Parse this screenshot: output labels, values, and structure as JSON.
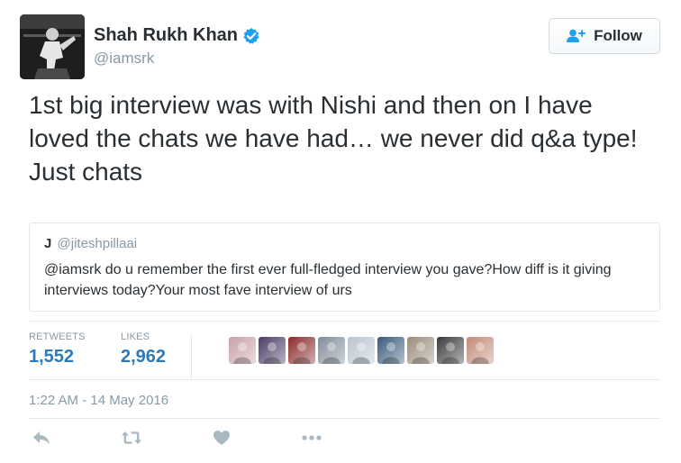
{
  "author": {
    "name": "Shah Rukh Khan",
    "handle": "@iamsrk",
    "verified": true
  },
  "follow_button": {
    "label": "Follow",
    "icon": "add-user-icon"
  },
  "tweet": {
    "text": "1st big interview was with Nishi and then on I have loved the chats we have had… we never did q&a type! Just chats"
  },
  "quoted_tweet": {
    "name": "J",
    "handle": "@jiteshpillaai",
    "text": "@iamsrk do u remember the first ever full-fledged interview you gave?How diff is it giving interviews today?Your most fave interview of urs"
  },
  "stats": {
    "retweets_label": "RETWEETS",
    "retweets_value": "1,552",
    "likes_label": "LIKES",
    "likes_value": "2,962"
  },
  "likers": [
    {
      "icon": "liker-avatar",
      "color": "#c9a0a8"
    },
    {
      "icon": "liker-avatar",
      "color": "#4a3a66"
    },
    {
      "icon": "liker-avatar",
      "color": "#8a2a2a"
    },
    {
      "icon": "liker-avatar",
      "color": "#7f8d9a"
    },
    {
      "icon": "liker-avatar",
      "color": "#b8c4d0"
    },
    {
      "icon": "liker-avatar",
      "color": "#3a5a7a"
    },
    {
      "icon": "liker-avatar",
      "color": "#9a8c7a"
    },
    {
      "icon": "liker-avatar",
      "color": "#3a3a3a"
    },
    {
      "icon": "liker-avatar",
      "color": "#c28a7a"
    }
  ],
  "timestamp": "1:22 AM - 14 May 2016",
  "actions": [
    {
      "name": "reply",
      "icon": "reply-icon"
    },
    {
      "name": "retweet",
      "icon": "retweet-icon"
    },
    {
      "name": "like",
      "icon": "heart-icon"
    },
    {
      "name": "more",
      "icon": "more-icon"
    }
  ],
  "colors": {
    "text": "#292f33",
    "muted": "#8899a6",
    "link": "#2b7bb9",
    "verified": "#1da1f2",
    "border": "#e1e8ed",
    "action_icon": "#aab8c2"
  }
}
